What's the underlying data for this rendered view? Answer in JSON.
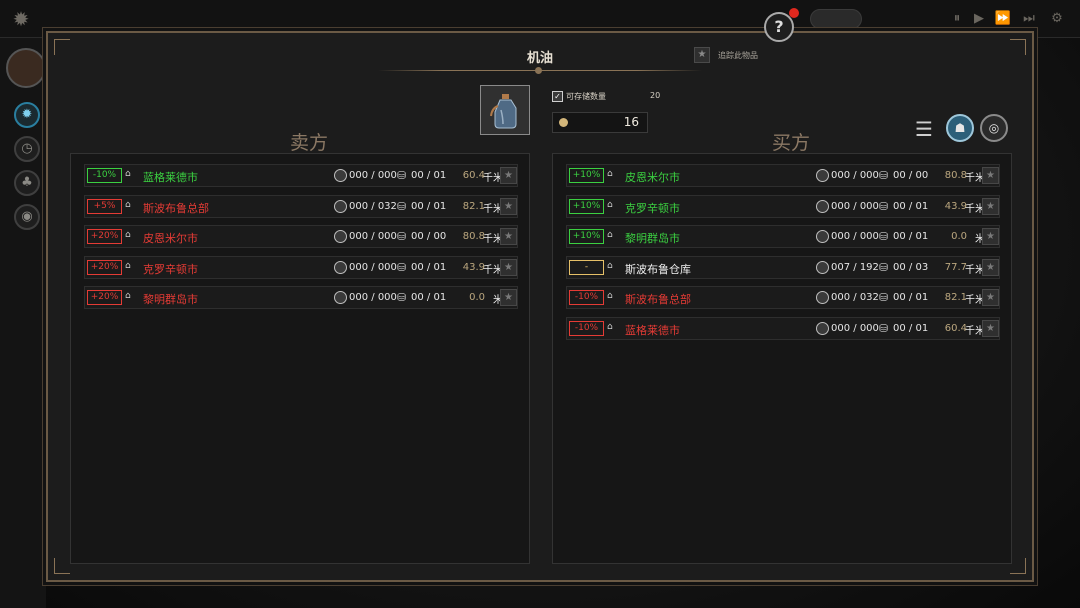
{
  "window": {
    "title": "机油",
    "track_label": "追踪此物品",
    "capacity_label": "可存储数量",
    "capacity_value": "20",
    "quantity": "16"
  },
  "sellers": {
    "title": "卖方",
    "rows": [
      {
        "badge": "-10%",
        "badge_color": "green",
        "name": "蓝格莱德市",
        "name_color": "green",
        "stock": "000 / 000",
        "trade": "00 / 01",
        "distance": "60.4",
        "unit": "千米"
      },
      {
        "badge": "+5%",
        "badge_color": "red",
        "name": "斯波布鲁总部",
        "name_color": "red",
        "stock": "000 / 032",
        "trade": "00 / 01",
        "distance": "82.1",
        "unit": "千米"
      },
      {
        "badge": "+20%",
        "badge_color": "red",
        "name": "皮恩米尔市",
        "name_color": "red",
        "stock": "000 / 000",
        "trade": "00 / 00",
        "distance": "80.8",
        "unit": "千米"
      },
      {
        "badge": "+20%",
        "badge_color": "red",
        "name": "克罗辛顿市",
        "name_color": "red",
        "stock": "000 / 000",
        "trade": "00 / 01",
        "distance": "43.9",
        "unit": "千米"
      },
      {
        "badge": "+20%",
        "badge_color": "red",
        "name": "黎明群岛市",
        "name_color": "red",
        "stock": "000 / 000",
        "trade": "00 / 01",
        "distance": "0.0",
        "unit": "米"
      }
    ]
  },
  "buyers": {
    "title": "买方",
    "rows": [
      {
        "badge": "+10%",
        "badge_color": "green",
        "name": "皮恩米尔市",
        "name_color": "green",
        "stock": "000 / 000",
        "trade": "00 / 00",
        "distance": "80.8",
        "unit": "千米"
      },
      {
        "badge": "+10%",
        "badge_color": "green",
        "name": "克罗辛顿市",
        "name_color": "green",
        "stock": "000 / 000",
        "trade": "00 / 01",
        "distance": "43.9",
        "unit": "千米"
      },
      {
        "badge": "+10%",
        "badge_color": "green",
        "name": "黎明群岛市",
        "name_color": "green",
        "stock": "000 / 000",
        "trade": "00 / 01",
        "distance": "0.0",
        "unit": "米"
      },
      {
        "badge": "-",
        "badge_color": "gold",
        "name": "斯波布鲁仓库",
        "name_color": "white",
        "stock": "007 / 192",
        "trade": "00 / 03",
        "distance": "77.7",
        "unit": "千米"
      },
      {
        "badge": "-10%",
        "badge_color": "red",
        "name": "斯波布鲁总部",
        "name_color": "red",
        "stock": "000 / 032",
        "trade": "00 / 01",
        "distance": "82.1",
        "unit": "千米"
      },
      {
        "badge": "-10%",
        "badge_color": "red",
        "name": "蓝格莱德市",
        "name_color": "red",
        "stock": "000 / 000",
        "trade": "00 / 01",
        "distance": "60.4",
        "unit": "千米"
      }
    ]
  },
  "icons": {
    "settings": "gear-icon",
    "help": "question-icon",
    "star": "star-icon",
    "sort": "sort-icon",
    "filter_a": "filter-icon",
    "filter_b": "target-icon"
  }
}
